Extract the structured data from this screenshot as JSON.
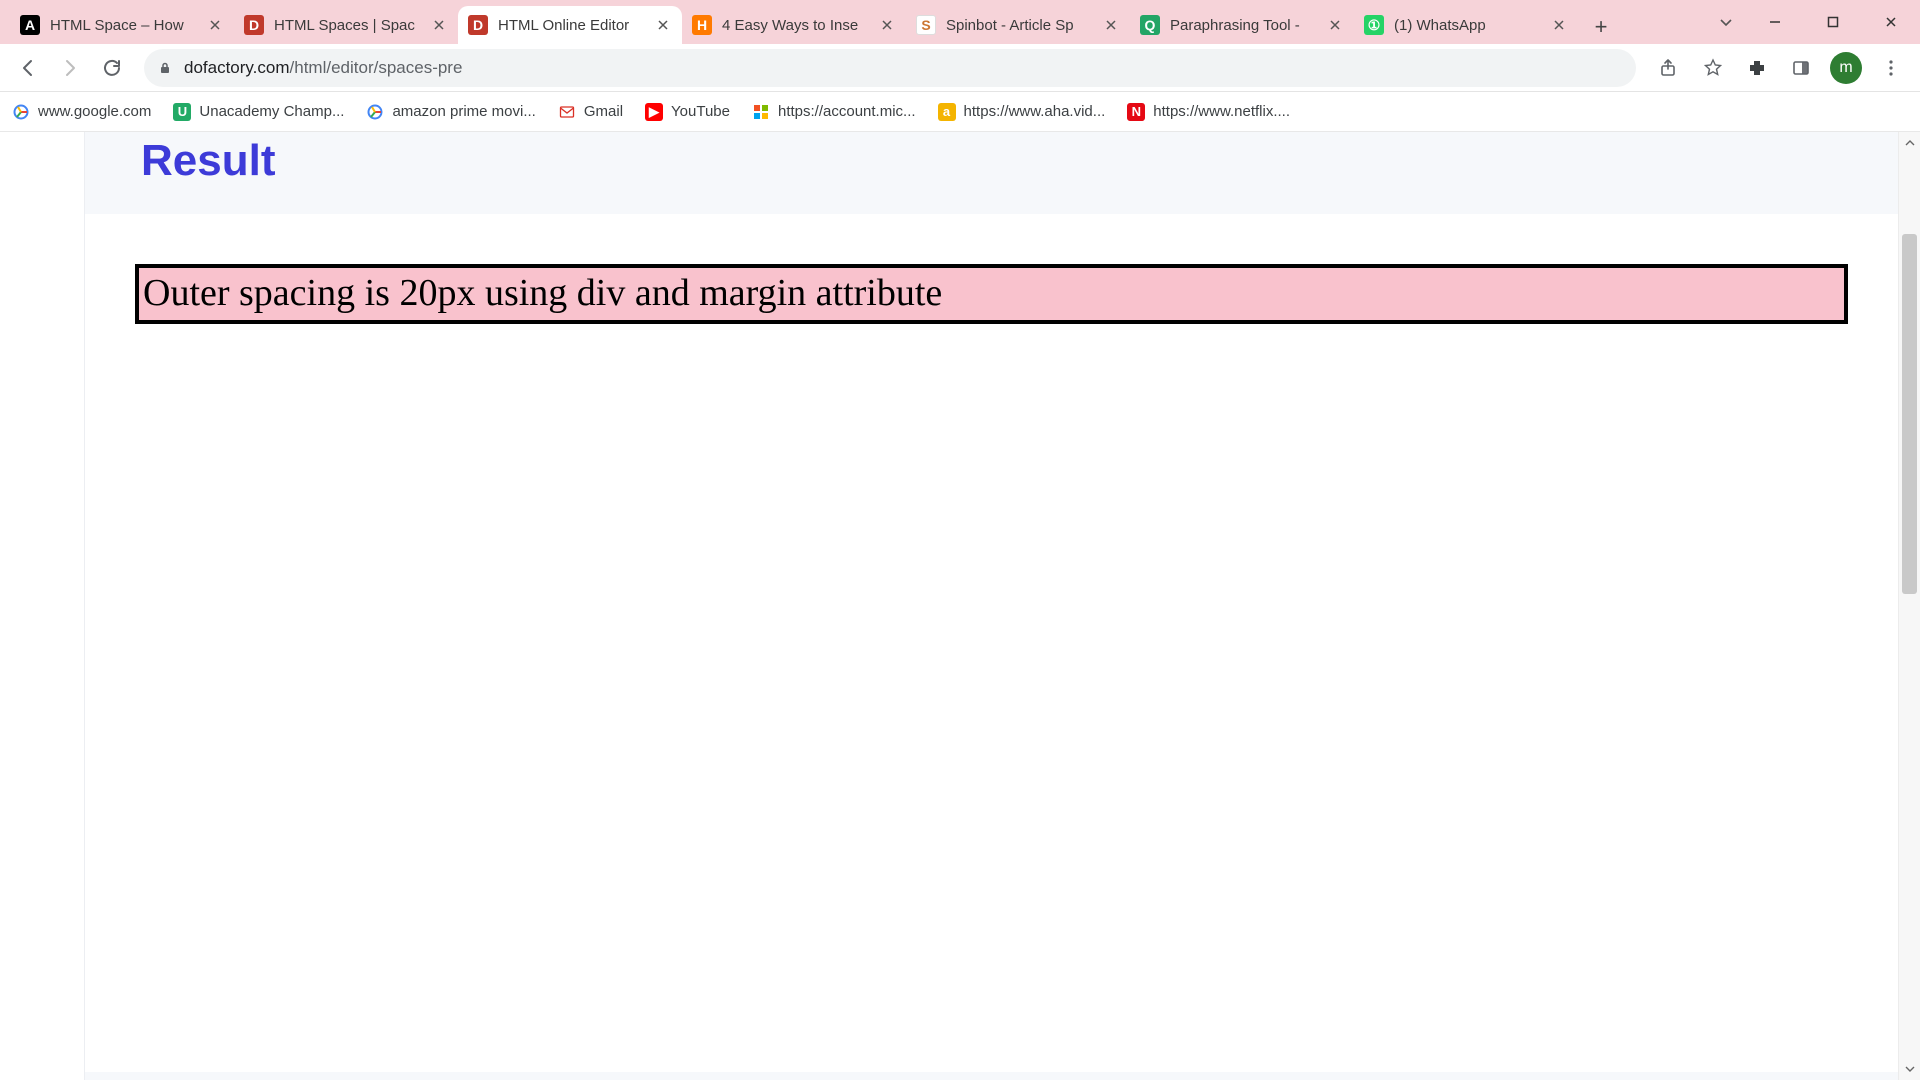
{
  "tabs": [
    {
      "title": "HTML Space – How",
      "favicon": "fc-black",
      "glyph": "A"
    },
    {
      "title": "HTML Spaces | Spac",
      "favicon": "fc-dored",
      "glyph": "D"
    },
    {
      "title": "HTML Online Editor",
      "favicon": "fc-dored",
      "glyph": "D",
      "active": true
    },
    {
      "title": "4 Easy Ways to Inse",
      "favicon": "fc-hub",
      "glyph": "H"
    },
    {
      "title": "Spinbot - Article Sp",
      "favicon": "fc-spin",
      "glyph": "S"
    },
    {
      "title": "Paraphrasing Tool -",
      "favicon": "fc-quill",
      "glyph": "Q"
    },
    {
      "title": "(1) WhatsApp",
      "favicon": "fc-wa",
      "glyph": "①"
    }
  ],
  "omnibox": {
    "domain": "dofactory.com",
    "path": "/html/editor/spaces-pre"
  },
  "avatar_letter": "m",
  "bookmarks": [
    {
      "label": "www.google.com",
      "icon": "fc-google",
      "glyph": "G"
    },
    {
      "label": "Unacademy Champ...",
      "icon": "fc-un",
      "glyph": "U"
    },
    {
      "label": "amazon prime movi...",
      "icon": "fc-google",
      "glyph": "G"
    },
    {
      "label": "Gmail",
      "icon": "fc-gmail",
      "glyph": "M"
    },
    {
      "label": "YouTube",
      "icon": "fc-yt",
      "glyph": "▶"
    },
    {
      "label": "https://account.mic...",
      "icon": "fc-ms",
      "glyph": "⊞"
    },
    {
      "label": "https://www.aha.vid...",
      "icon": "fc-aha",
      "glyph": "a"
    },
    {
      "label": "https://www.netflix....",
      "icon": "fc-nf",
      "glyph": "N"
    }
  ],
  "page": {
    "result_heading": "Result",
    "demo_text": "Outer spacing is 20px using div and margin attribute"
  }
}
